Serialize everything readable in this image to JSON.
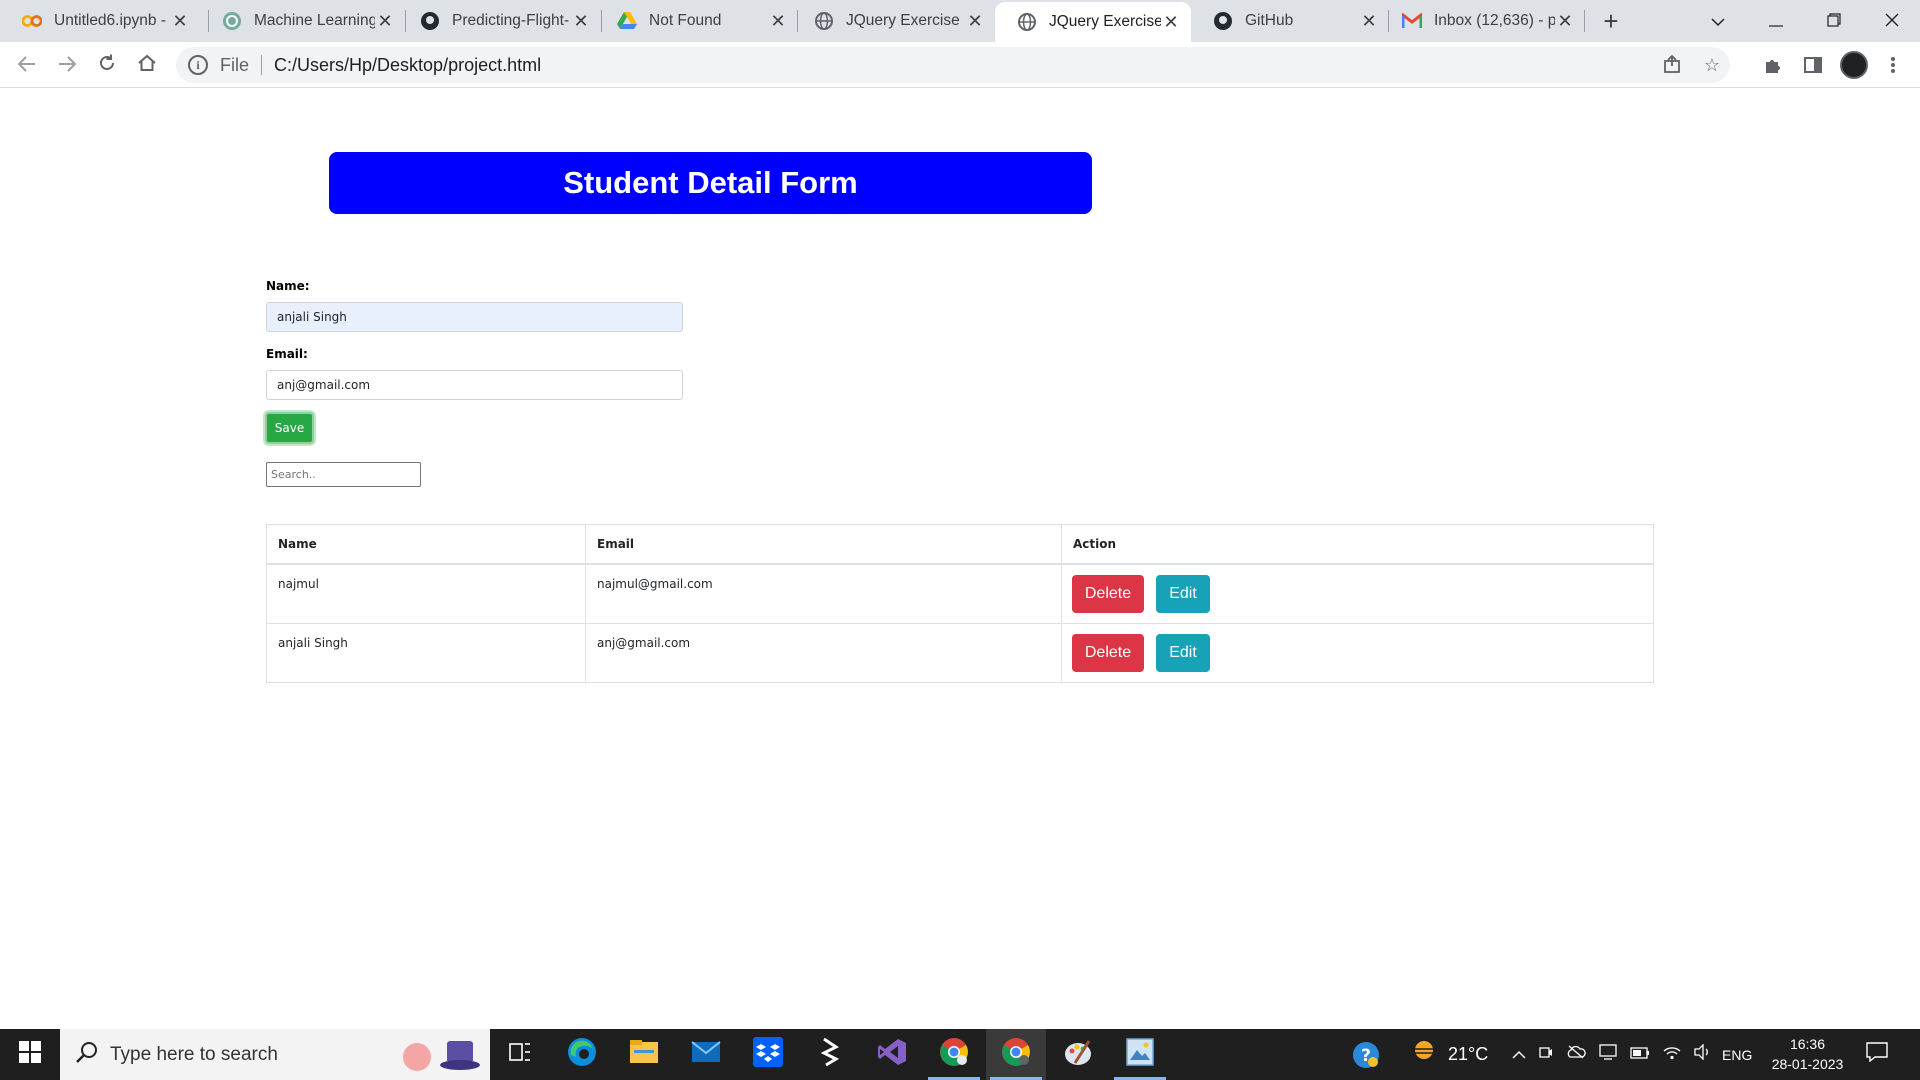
{
  "browser": {
    "tabs": [
      {
        "title": "Untitled6.ipynb - ",
        "favicon": "colab-icon"
      },
      {
        "title": "Machine Learning",
        "favicon": "chatgpt-icon"
      },
      {
        "title": "Predicting-Flight-",
        "favicon": "github-icon"
      },
      {
        "title": "Not Found",
        "favicon": "google-drive-icon"
      },
      {
        "title": "JQuery Exercise",
        "favicon": "globe-icon"
      },
      {
        "title": "JQuery Exercise",
        "favicon": "globe-icon",
        "active": true
      },
      {
        "title": "GitHub",
        "favicon": "github-icon"
      },
      {
        "title": "Inbox (12,636) - p",
        "favicon": "gmail-icon"
      }
    ],
    "address": {
      "scheme": "File",
      "url": "C:/Users/Hp/Desktop/project.html"
    }
  },
  "page": {
    "banner_title": "Student Detail Form",
    "form": {
      "name_label": "Name:",
      "name_value": "anjali Singh",
      "email_label": "Email:",
      "email_value": "anj@gmail.com",
      "save_label": "Save"
    },
    "search_placeholder": "Search..",
    "table": {
      "headers": [
        "Name",
        "Email",
        "Action"
      ],
      "rows": [
        {
          "name": "najmul",
          "email": "najmul@gmail.com",
          "delete_label": "Delete",
          "edit_label": "Edit"
        },
        {
          "name": "anjali Singh",
          "email": "anj@gmail.com",
          "delete_label": "Delete",
          "edit_label": "Edit"
        }
      ]
    },
    "colors": {
      "banner": "#0000ff",
      "save": "#28a745",
      "delete": "#dc3545",
      "edit": "#17a2b8"
    }
  },
  "taskbar": {
    "search_placeholder": "Type here to search",
    "weather": "21°C",
    "language": "ENG",
    "time": "16:36",
    "date": "28-01-2023"
  }
}
